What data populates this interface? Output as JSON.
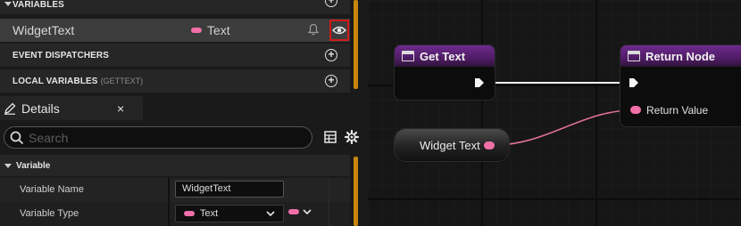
{
  "my_blueprint": {
    "variables_label": "VARIABLES",
    "variable": {
      "name": "WidgetText",
      "type": "Text"
    },
    "event_dispatchers_label": "EVENT DISPATCHERS",
    "local_variables_label": "LOCAL VARIABLES",
    "local_variables_scope": "(GETTEXT)"
  },
  "details": {
    "tab_label": "Details",
    "close_glyph": "×",
    "search_placeholder": "Search",
    "section_label": "Variable",
    "properties": [
      {
        "label": "Variable Name",
        "value": "WidgetText"
      },
      {
        "label": "Variable Type",
        "value": "Text"
      }
    ]
  },
  "graph": {
    "get_text_node": {
      "title": "Get Text"
    },
    "return_node": {
      "title": "Return Node",
      "pin_label": "Return Value"
    },
    "variable_node": {
      "label": "Widget Text"
    }
  },
  "colors": {
    "text_pin": "#f06fa8",
    "function_header": "#6e2a8e",
    "highlight": "#d01818",
    "scrollbar": "#c8860c"
  },
  "icons": [
    "plus-circle-icon",
    "bell-icon",
    "eye-icon",
    "pencil-icon",
    "search-icon",
    "grid-view-icon",
    "gear-icon",
    "chevron-down-icon",
    "function-icon",
    "exec-pin-icon"
  ]
}
